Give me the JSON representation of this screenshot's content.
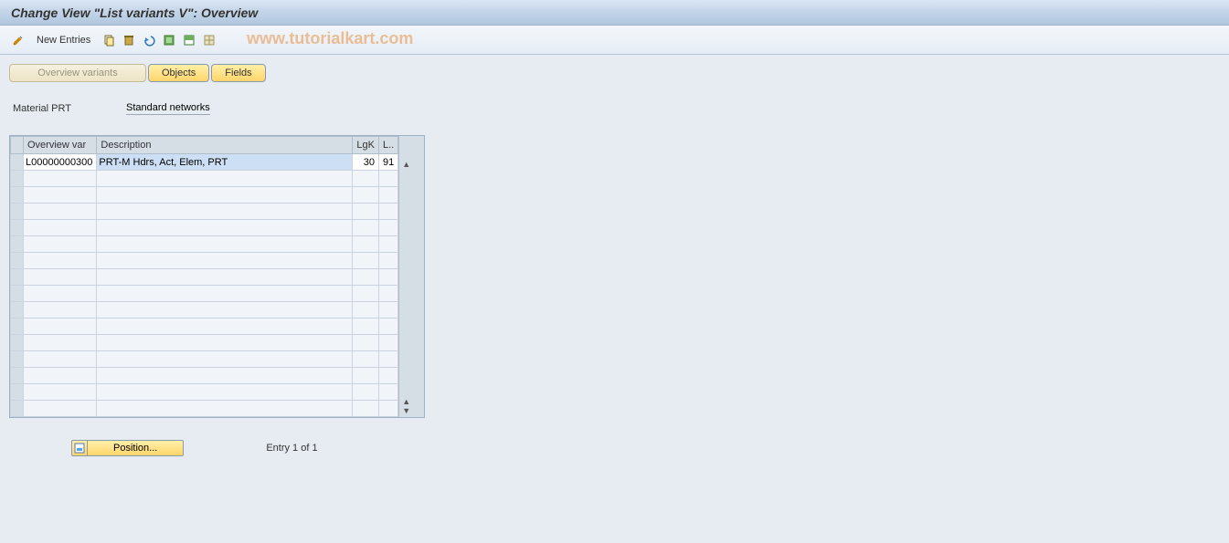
{
  "title": "Change View \"List variants                 V\": Overview",
  "toolbar": {
    "new_entries": "New Entries"
  },
  "watermark": "www.tutorialkart.com",
  "tabs": {
    "overview": "Overview variants",
    "objects": "Objects",
    "fields": "Fields"
  },
  "info": {
    "label": "Material PRT",
    "value": "Standard networks"
  },
  "table": {
    "headers": {
      "overview_var": "Overview var",
      "description": "Description",
      "lgk": "LgK",
      "l": "L.."
    },
    "rows": [
      {
        "overview_var": "L00000000300",
        "description": "PRT-M Hdrs, Act, Elem, PRT",
        "lgk": "30",
        "l": "91"
      }
    ]
  },
  "footer": {
    "position": "Position...",
    "entry_text": "Entry 1 of 1"
  }
}
